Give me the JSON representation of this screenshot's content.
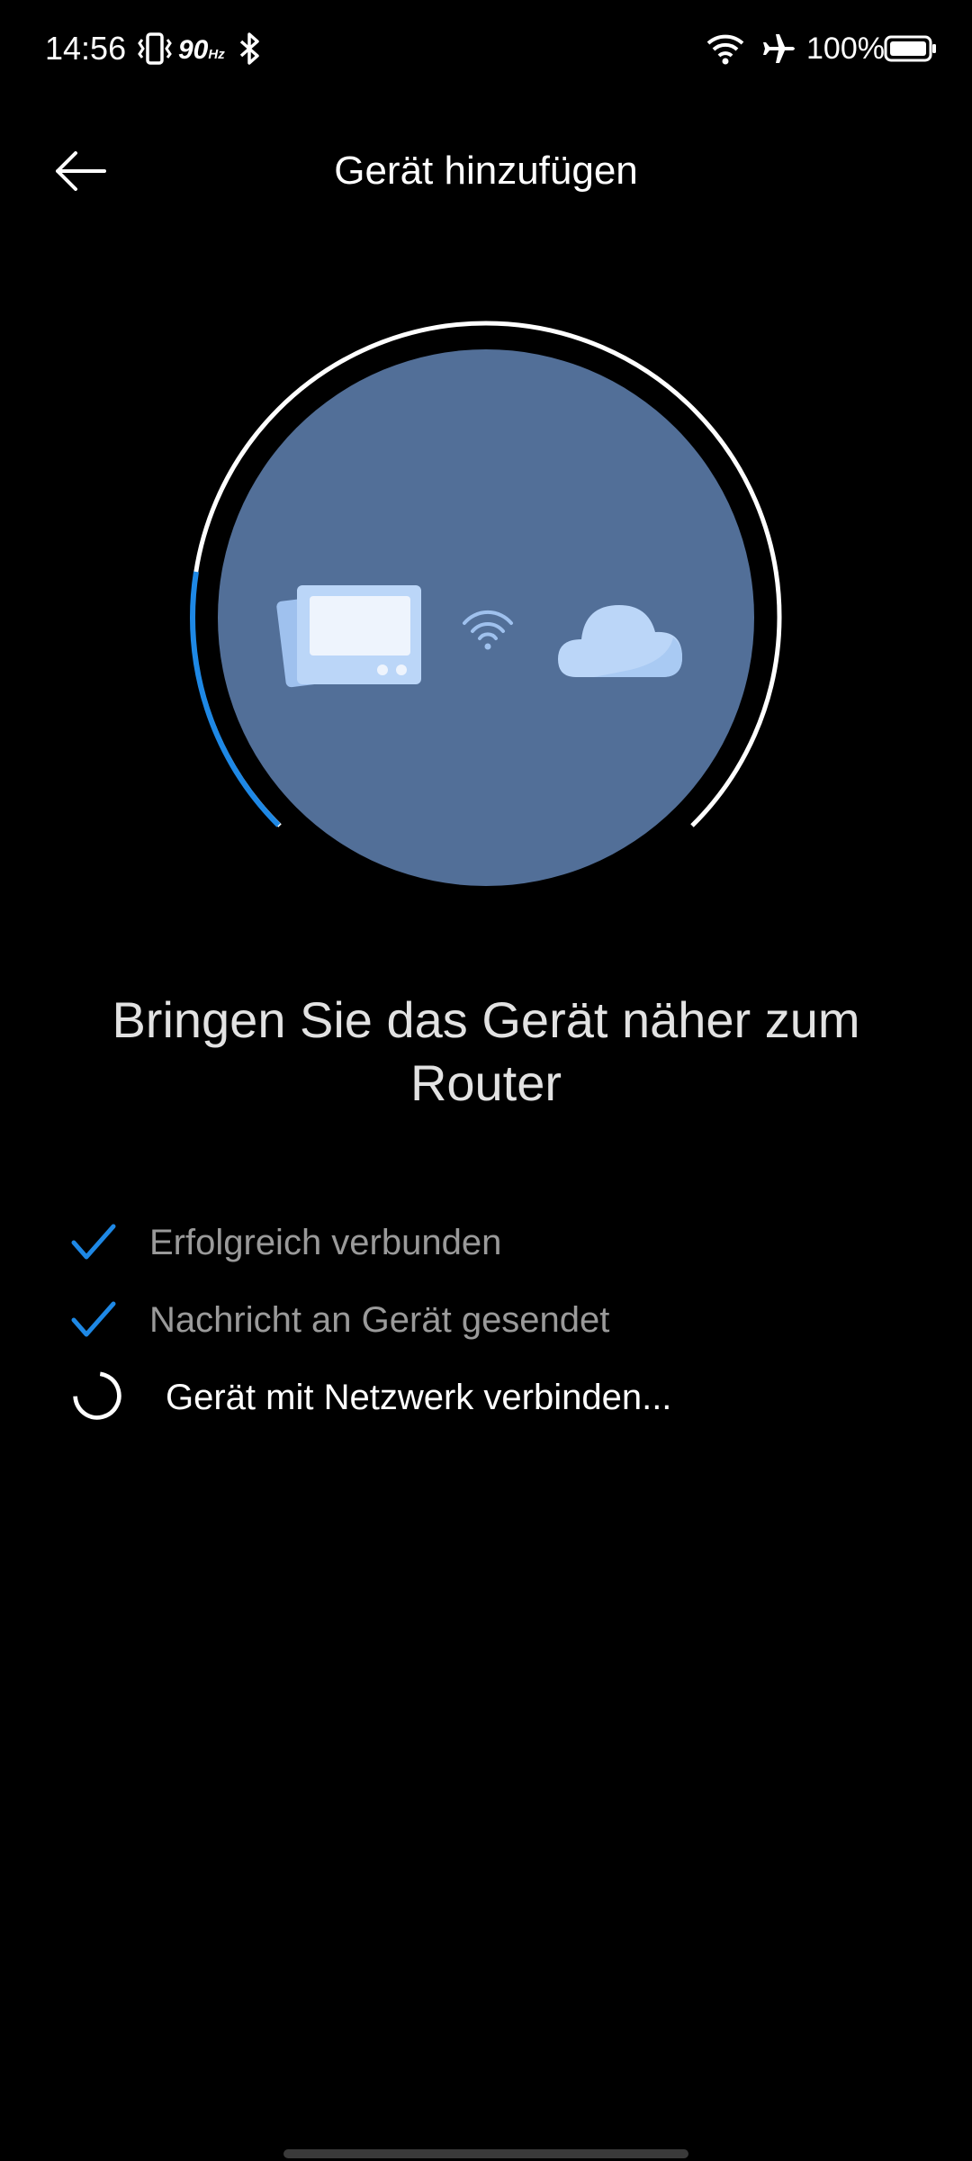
{
  "status_bar": {
    "time": "14:56",
    "refresh_rate": "90",
    "refresh_unit": "Hz",
    "battery": "100%",
    "icons": [
      "vibrate-icon",
      "bluetooth-icon",
      "wifi-icon",
      "airplane-mode-icon",
      "battery-icon"
    ]
  },
  "header": {
    "back_icon": "arrow-left-icon",
    "title": "Gerät hinzufügen"
  },
  "illustration": {
    "progress_fraction": 0.2,
    "colors": {
      "circle_fill": "#526F98",
      "ring_track": "#ffffff",
      "ring_progress": "#1E88E5",
      "device": "#BBD6F8",
      "cloud": "#BBD6F8"
    },
    "icons": [
      "device-icon",
      "wifi-signal-icon",
      "cloud-icon"
    ]
  },
  "instruction": "Bringen Sie das Gerät näher zum Router",
  "steps": [
    {
      "label": "Erfolgreich verbunden",
      "status": "done",
      "icon": "checkmark-icon"
    },
    {
      "label": "Nachricht an Gerät gesendet",
      "status": "done",
      "icon": "checkmark-icon"
    },
    {
      "label": "Gerät mit Netzwerk verbinden...",
      "status": "in-progress",
      "icon": "loading-spinner-icon"
    }
  ],
  "accent_color": "#1E88E5"
}
